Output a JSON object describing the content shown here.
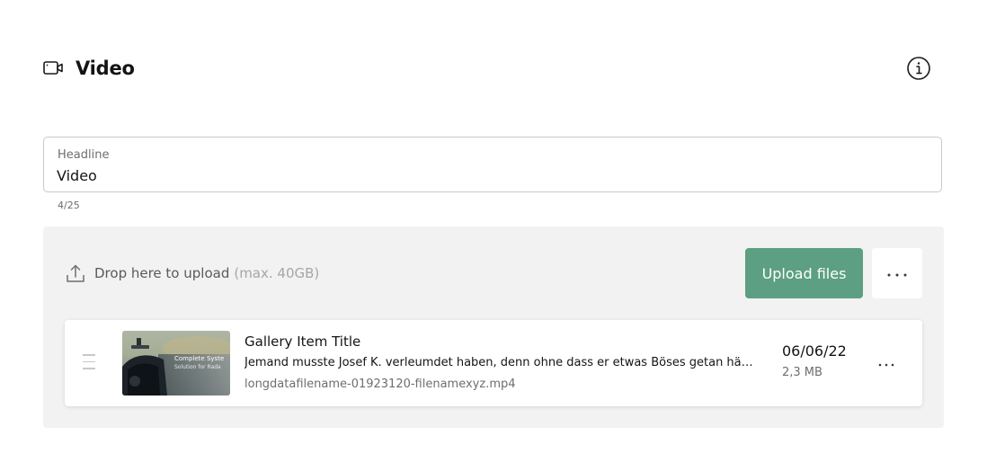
{
  "header": {
    "title": "Video",
    "icon": "video-camera-icon",
    "info_icon": "info-icon"
  },
  "headline_field": {
    "label": "Headline",
    "value": "Video",
    "counter": "4/25"
  },
  "upload_panel": {
    "drop_text": "Drop here to upload",
    "drop_hint": "(max. 40GB)",
    "upload_button_label": "Upload files",
    "upload_icon": "upload-icon",
    "more_icon": "more-horizontal-icon"
  },
  "items": [
    {
      "title": "Gallery Item Title",
      "description": "Jemand musste Josef K. verleumdet haben, denn ohne dass er etwas Böses getan hätte, wurde er eines Morgens verhaftet.",
      "filename": "longdatafilename-01923120-filenamexyz.mp4",
      "date": "06/06/22",
      "size": "2,3 MB",
      "thumbnail_caption_line1": "Complete Syste",
      "thumbnail_caption_line2": "Solution for Rada"
    }
  ],
  "colors": {
    "accent": "#5c9f82",
    "panel_bg": "#f2f2f2",
    "border": "#c9c9c9"
  }
}
